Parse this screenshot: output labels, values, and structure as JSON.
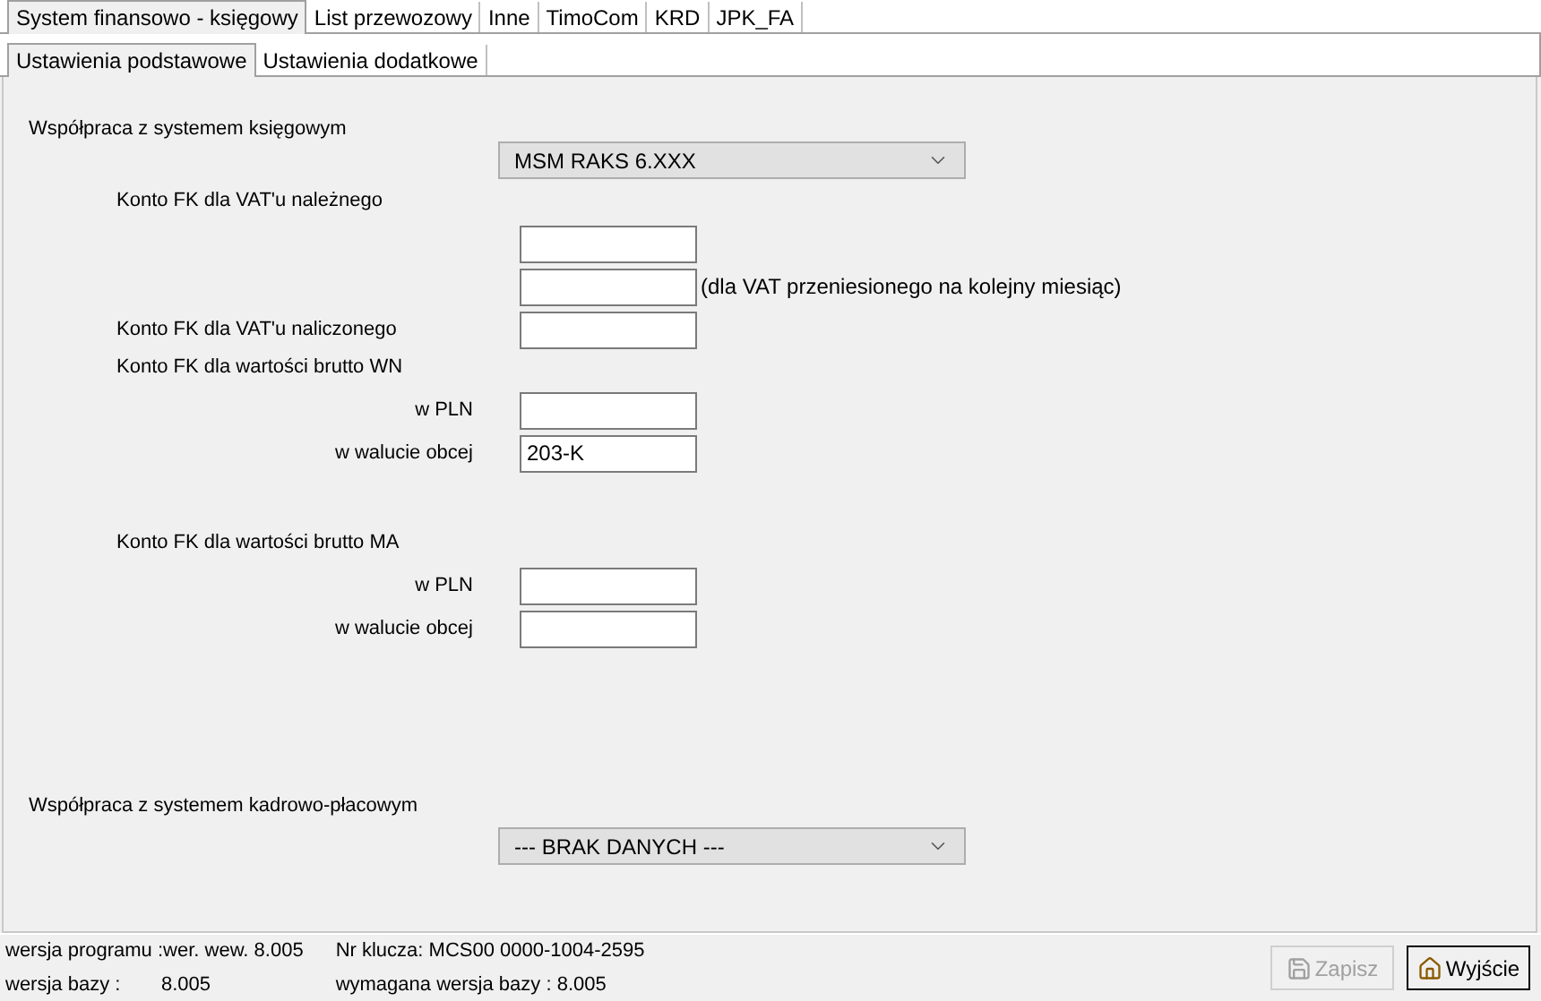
{
  "tabs": [
    {
      "label": "System finansowo - księgowy",
      "selected": true
    },
    {
      "label": "List przewozowy",
      "selected": false
    },
    {
      "label": "Inne",
      "selected": false
    },
    {
      "label": "TimoCom",
      "selected": false
    },
    {
      "label": "KRD",
      "selected": false
    },
    {
      "label": "JPK_FA",
      "selected": false
    }
  ],
  "subtabs": [
    {
      "label": "Ustawienia podstawowe",
      "selected": true
    },
    {
      "label": "Ustawienia dodatkowe",
      "selected": false
    }
  ],
  "accounting": {
    "heading": "Współpraca z systemem księgowym",
    "select": "MSM RAKS 6.XXX",
    "vat_due": {
      "label": "Konto FK dla VAT'u należnego",
      "note": "(dla VAT przeniesionego na kolejny miesiąc)"
    },
    "vat_input": {
      "label": "Konto FK dla VAT'u naliczonego"
    },
    "gross_wn": {
      "label": "Konto FK dla wartości brutto WN",
      "pln_label": "w PLN",
      "foreign_label": "w walucie obcej",
      "foreign_value": "203-K"
    },
    "gross_ma": {
      "label": "Konto FK dla wartości brutto MA",
      "pln_label": "w PLN",
      "foreign_label": "w walucie obcej"
    }
  },
  "payroll": {
    "heading": "Współpraca z systemem kadrowo-płacowym",
    "select": "--- BRAK DANYCH ---"
  },
  "status_bar": {
    "program_version_label": "wersja programu :",
    "program_version": "wer. wew. 8.005",
    "db_version_label": "wersja bazy :",
    "db_version": "8.005",
    "key": "Nr klucza: MCS00 0000-1004-2595",
    "required_db": "wymagana wersja bazy : 8.005"
  },
  "buttons": [
    {
      "label": "Zapisz",
      "disabled": true
    },
    {
      "label": "Wyjście",
      "disabled": false
    }
  ]
}
